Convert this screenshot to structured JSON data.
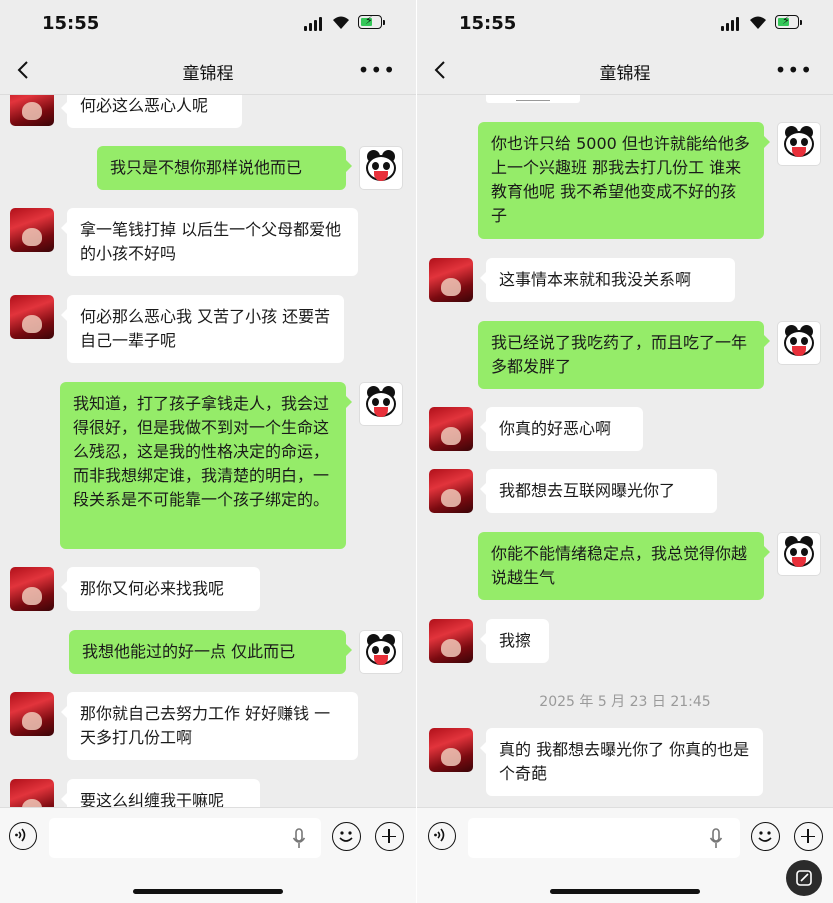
{
  "status": {
    "time": "15:55"
  },
  "chat": {
    "title": "童锦程"
  },
  "left": {
    "messages": [
      {
        "side": "in",
        "text": "何必这么恶心人呢"
      },
      {
        "side": "out",
        "text": "我只是不想你那样说他而已"
      },
      {
        "side": "in",
        "text": "拿一笔钱打掉 以后生一个父母都爱他的小孩不好吗"
      },
      {
        "side": "in",
        "text": "何必那么恶心我 又苦了小孩 还要苦自己一辈子呢"
      },
      {
        "side": "out",
        "text": "我知道，打了孩子拿钱走人，我会过得很好，但是我做不到对一个生命这么残忍，这是我的性格决定的命运，而非我想绑定谁，我清楚的明白，一段关系是不可能靠一个孩子绑定的。"
      },
      {
        "side": "in",
        "text": "那你又何必来找我呢"
      },
      {
        "side": "out",
        "text": "我想他能过的好一点 仅此而已"
      },
      {
        "side": "in",
        "text": "那你就自己去努力工作 好好赚钱 一天多打几份工啊"
      },
      {
        "side": "in",
        "text": "要这么纠缠我干嘛呢"
      }
    ]
  },
  "right": {
    "messages": [
      {
        "side": "out",
        "text": "你也许只给 5000 但也许就能给他多上一个兴趣班 那我去打几份工 谁来教育他呢 我不希望他变成不好的孩子"
      },
      {
        "side": "in",
        "text": "这事情本来就和我没关系啊"
      },
      {
        "side": "out",
        "text": "我已经说了我吃药了，而且吃了一年多都发胖了"
      },
      {
        "side": "in",
        "text": "你真的好恶心啊"
      },
      {
        "side": "in",
        "text": "我都想去互联网曝光你了"
      },
      {
        "side": "out",
        "text": "你能不能情绪稳定点，我总觉得你越说越生气"
      },
      {
        "side": "in",
        "text": "我擦"
      },
      {
        "side": "in",
        "text": "真的 我都想去曝光你了 你真的也是个奇葩"
      }
    ],
    "timestamp": "2025 年 5 月 23 日 21:45"
  },
  "icons": {
    "back": "chevron-left-icon",
    "more": "more-dots-icon",
    "voice": "voice-input-icon",
    "mic": "microphone-icon",
    "emoji": "emoji-icon",
    "plus": "plus-icon",
    "edit": "edit-icon"
  },
  "colors": {
    "out_bubble": "#95ec69",
    "in_bubble": "#ffffff",
    "background": "#ededed"
  }
}
